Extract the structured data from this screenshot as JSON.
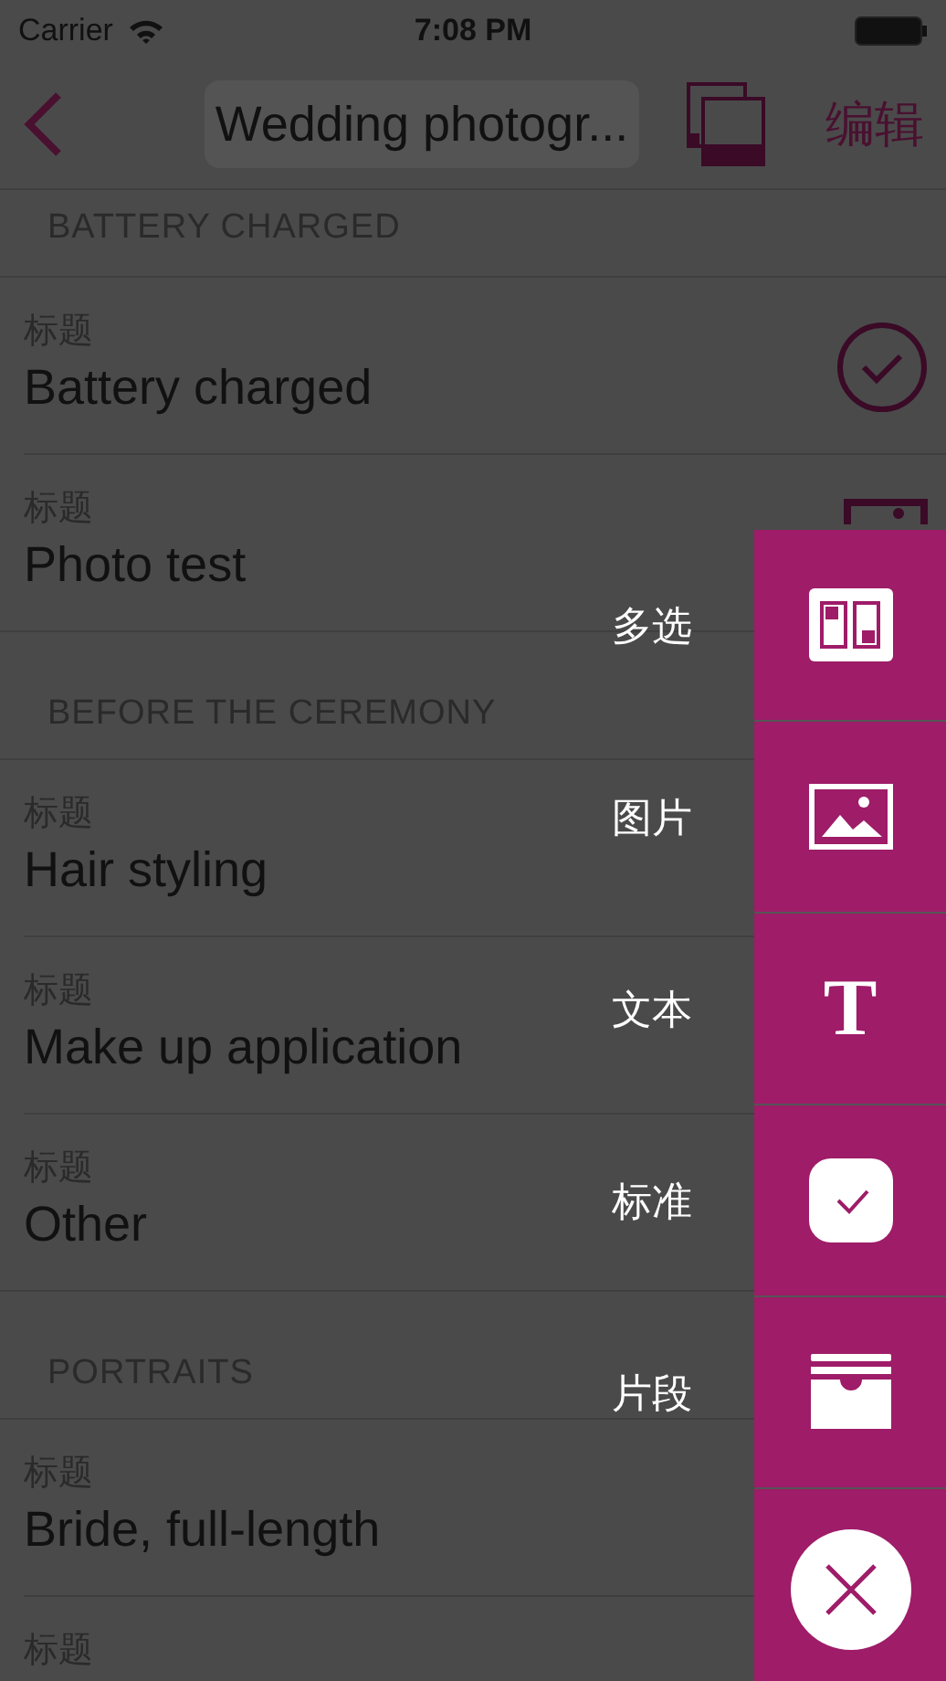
{
  "status_bar": {
    "carrier": "Carrier",
    "time": "7:08 PM"
  },
  "nav": {
    "title": "Wedding photogr...",
    "edit": "编辑"
  },
  "sections": [
    {
      "header": "BATTERY CHARGED",
      "rows": [
        {
          "label": "标题",
          "value": "Battery charged",
          "kind": "check"
        },
        {
          "label": "标题",
          "value": "Photo test",
          "kind": "photo"
        }
      ]
    },
    {
      "header": "BEFORE THE CEREMONY",
      "rows": [
        {
          "label": "标题",
          "value": "Hair styling",
          "kind": "plain"
        },
        {
          "label": "标题",
          "value": "Make up application",
          "kind": "plain"
        },
        {
          "label": "标题",
          "value": "Other",
          "kind": "plain"
        }
      ]
    },
    {
      "header": "PORTRAITS",
      "rows": [
        {
          "label": "标题",
          "value": "Bride, full-length",
          "kind": "plain"
        },
        {
          "label": "标题",
          "kind": "plain"
        }
      ]
    }
  ],
  "menu": {
    "items": [
      {
        "label": "多选",
        "kind": "multi"
      },
      {
        "label": "图片",
        "kind": "image"
      },
      {
        "label": "文本",
        "kind": "text",
        "glyph": "T"
      },
      {
        "label": "标准",
        "kind": "standard"
      },
      {
        "label": "片段",
        "kind": "segment"
      }
    ]
  }
}
